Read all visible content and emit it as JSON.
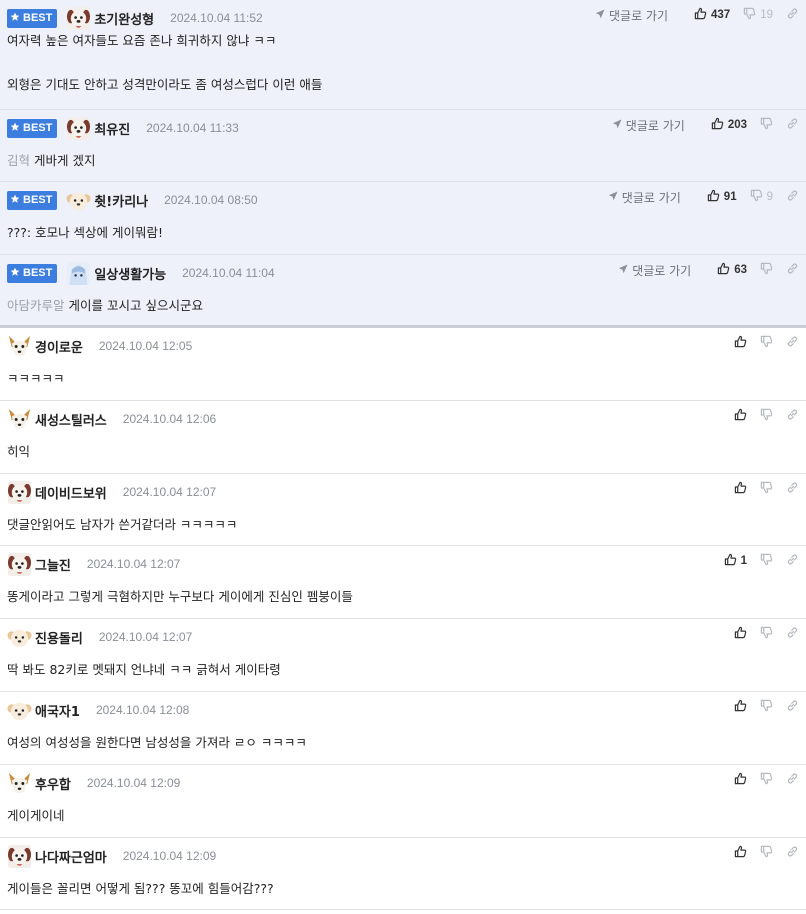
{
  "labels": {
    "best_badge": "BEST",
    "reply_link": "댓글로 가기"
  },
  "colors": {
    "best_background": "#eef1f9",
    "badge_blue": "#3b7ee0",
    "date_gray": "#8a8f97"
  },
  "comments": [
    {
      "best": true,
      "avatar_icon": "dog-avatar-icon",
      "nickname": "초기완성형",
      "date": "2024.10.04 11:52",
      "text": "여자력 높은 여자들도 요즘 존나 희귀하지 않냐 ㅋㅋ\n\n외형은 기대도 안하고 성격만이라도 좀 여성스럽다 이런 애들",
      "mention": "",
      "likes": "437",
      "dislikes": "19"
    },
    {
      "best": true,
      "avatar_icon": "dog-avatar-icon",
      "nickname": "최유진",
      "date": "2024.10.04 11:33",
      "text": "게바게 겠지",
      "mention": "김혁",
      "likes": "203",
      "dislikes": ""
    },
    {
      "best": true,
      "avatar_icon": "puppy-avatar-icon",
      "nickname": "췻!카리나",
      "date": "2024.10.04 08:50",
      "text": "???: 호모나 섹상에 게이뭐람!",
      "mention": "",
      "likes": "91",
      "dislikes": "9"
    },
    {
      "best": true,
      "avatar_icon": "character-avatar-icon",
      "nickname": "일상생활가능",
      "date": "2024.10.04 11:04",
      "text": "게이를 꼬시고 싶으시군요",
      "mention": "아담카루알",
      "likes": "63",
      "dislikes": ""
    },
    {
      "best": false,
      "avatar_icon": "chihuahua-avatar-icon",
      "nickname": "경이로운",
      "date": "2024.10.04 12:05",
      "text": "ㅋㅋㅋㅋㅋ",
      "mention": "",
      "likes": "",
      "dislikes": ""
    },
    {
      "best": false,
      "avatar_icon": "chihuahua-avatar-icon",
      "nickname": "새성스틸러스",
      "date": "2024.10.04 12:06",
      "text": "히익",
      "mention": "",
      "likes": "",
      "dislikes": ""
    },
    {
      "best": false,
      "avatar_icon": "dog-avatar-icon",
      "nickname": "데이비드보위",
      "date": "2024.10.04 12:07",
      "text": "댓글안읽어도 남자가 쓴거같더라 ㅋㅋㅋㅋㅋ",
      "mention": "",
      "likes": "",
      "dislikes": ""
    },
    {
      "best": false,
      "avatar_icon": "dog-avatar-icon",
      "nickname": "그늘진",
      "date": "2024.10.04 12:07",
      "text": "똥게이라고 그렇게 극혐하지만 누구보다 게이에게 진심인 펨붕이들",
      "mention": "",
      "likes": "1",
      "dislikes": ""
    },
    {
      "best": false,
      "avatar_icon": "puppy-avatar-icon",
      "nickname": "진용돌리",
      "date": "2024.10.04 12:07",
      "text": "딱 봐도 82키로 멧돼지 언냐네 ㅋㅋ 긁혀서 게이타령",
      "mention": "",
      "likes": "",
      "dislikes": ""
    },
    {
      "best": false,
      "avatar_icon": "puppy-avatar-icon",
      "nickname": "애국자1",
      "date": "2024.10.04 12:08",
      "text": "여성의 여성성을 원한다면 남성성을 가져라 ㄹㅇ ㅋㅋㅋㅋ",
      "mention": "",
      "likes": "",
      "dislikes": ""
    },
    {
      "best": false,
      "avatar_icon": "chihuahua-avatar-icon",
      "nickname": "후우합",
      "date": "2024.10.04 12:09",
      "text": "게이게이네",
      "mention": "",
      "likes": "",
      "dislikes": ""
    },
    {
      "best": false,
      "avatar_icon": "dog-avatar-icon",
      "nickname": "나다짜근엄마",
      "date": "2024.10.04 12:09",
      "text": "게이들은 꼴리면 어떻게 됨??? 똥꼬에 힘들어감???",
      "mention": "",
      "likes": "",
      "dislikes": ""
    }
  ]
}
